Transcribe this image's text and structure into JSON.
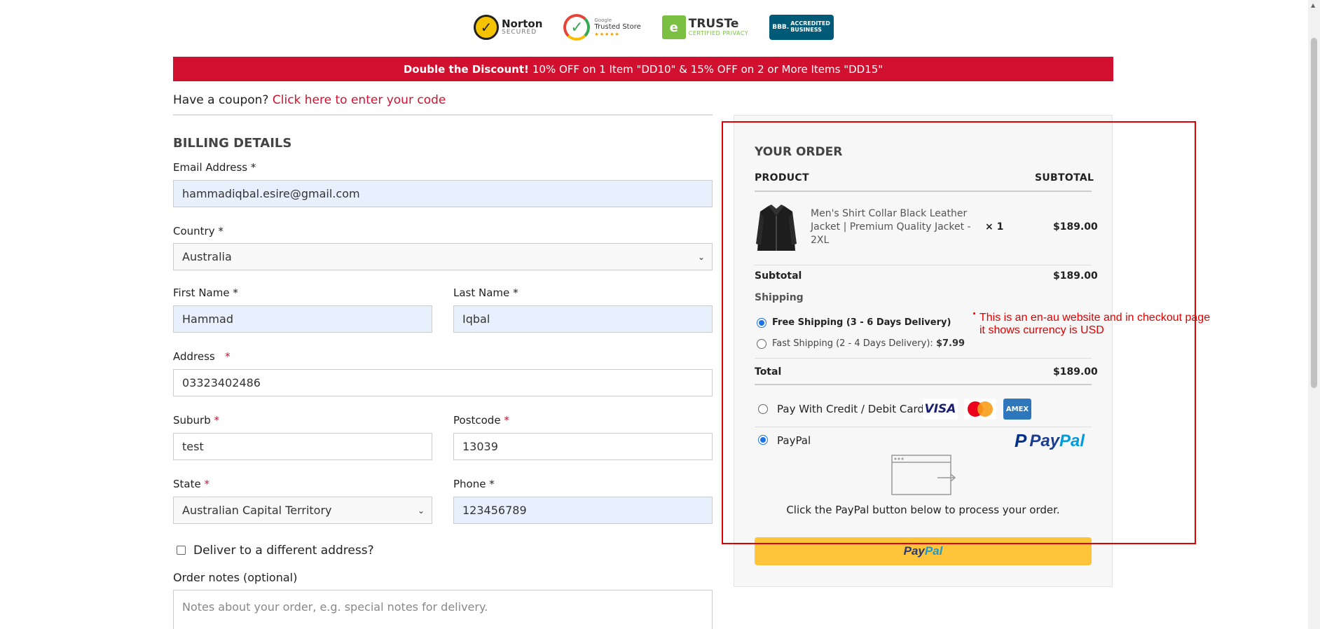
{
  "badges": {
    "norton": {
      "title": "Norton",
      "subtitle": "SECURED"
    },
    "google": {
      "small": "Google",
      "title": "Trusted Store",
      "stars": "★★★★★"
    },
    "truste": {
      "title": "TRUSTe",
      "subtitle": "CERTIFIED PRIVACY"
    },
    "bbb": {
      "logo": "BBB.",
      "line1": "ACCREDITED",
      "line2": "BUSINESS"
    }
  },
  "promo": {
    "bold": "Double the Discount!",
    "text": "10% OFF on 1 Item \"DD10\" & 15% OFF on 2 or More Items \"DD15\""
  },
  "coupon": {
    "question": "Have a coupon?",
    "link": "Click here to enter your code"
  },
  "billing": {
    "title": "BILLING DETAILS",
    "email": {
      "label": "Email Address",
      "req": "*",
      "value": "hammadiqbal.esire@gmail.com"
    },
    "country": {
      "label": "Country",
      "req": "*",
      "value": "Australia"
    },
    "first_name": {
      "label": "First Name",
      "req": "*",
      "value": "Hammad"
    },
    "last_name": {
      "label": "Last Name",
      "req": "*",
      "value": "Iqbal"
    },
    "address": {
      "label": "Address",
      "req": "*",
      "value": "03323402486"
    },
    "suburb": {
      "label": "Suburb",
      "req": "*",
      "value": "test"
    },
    "postcode": {
      "label": "Postcode",
      "req": "*",
      "value": "13039"
    },
    "state": {
      "label": "State",
      "req": "*",
      "value": "Australian Capital Territory"
    },
    "phone": {
      "label": "Phone",
      "req": "*",
      "value": "123456789"
    },
    "deliver_different": "Deliver to a different address?",
    "order_notes": {
      "label": "Order notes (optional)",
      "placeholder": "Notes about your order, e.g. special notes for delivery."
    }
  },
  "order": {
    "title": "YOUR ORDER",
    "col_product": "PRODUCT",
    "col_subtotal": "SUBTOTAL",
    "item": {
      "name": "Men's Shirt Collar Black Leather Jacket | Premium Quality Jacket - 2XL",
      "qty": "× 1",
      "price": "$189.00"
    },
    "subtotal_label": "Subtotal",
    "subtotal_value": "$189.00",
    "shipping_label": "Shipping",
    "shipping_options": [
      {
        "label": "Free Shipping (3 - 6 Days Delivery)",
        "price": "",
        "selected": true
      },
      {
        "label": "Fast Shipping (2 - 4 Days Delivery):",
        "price": "$7.99",
        "selected": false
      }
    ],
    "total_label": "Total",
    "total_value": "$189.00",
    "payment": {
      "card_label": "Pay With Credit / Debit Card",
      "visa": "VISA",
      "amex": "AMEX",
      "paypal_label": "PayPal",
      "paypal_logo_pay": "Pay",
      "paypal_logo_pal": "Pal",
      "paypal_note": "Click the PayPal button below to process your order.",
      "paypal_button_pay": "Pay",
      "paypal_button_pal": "Pal"
    }
  },
  "annotation": "This is an en-au website and in checkout page it shows currency is USD",
  "colors": {
    "brand_red": "#d0102e",
    "annotation_red": "#e10000",
    "paypal_yellow": "#ffc439",
    "autofill_blue": "#e8f0fe"
  }
}
